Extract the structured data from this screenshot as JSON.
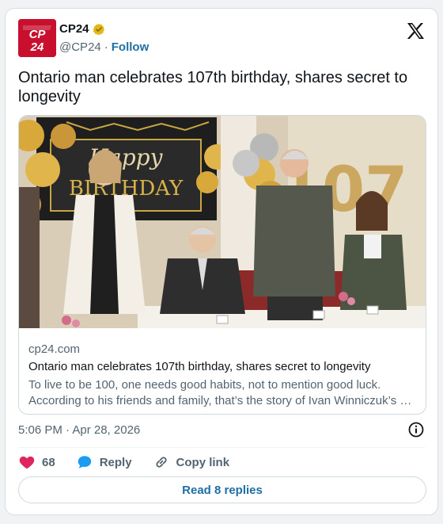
{
  "author": {
    "name": "CP24",
    "handle": "@CP24",
    "separator": "·",
    "follow_label": "Follow",
    "avatar_text": "CP24",
    "verified_color": "#e2b719",
    "brand_color": "#c8102e"
  },
  "tweet": {
    "text": "Ontario man celebrates 107th birthday, shares secret to longevity"
  },
  "link_card": {
    "domain": "cp24.com",
    "title": "Ontario man celebrates 107th birthday, shares secret to longevity",
    "description_line1": "To live to be 100, one needs good habits, not to mention good luck.",
    "description_line2": "According to his friends and family, that’s the story of Ivan Winniczuk’s …",
    "image_banner_text_1": "Happy",
    "image_banner_text_2": "BIRTHDAY",
    "image_balloon_number": "107"
  },
  "meta": {
    "timestamp": "5:06 PM · Apr 28, 2026"
  },
  "actions": {
    "like_count": "68",
    "reply_label": "Reply",
    "copy_link_label": "Copy link",
    "like_color": "#e0245e",
    "reply_color": "#1d9bf0"
  },
  "footer": {
    "read_replies_label": "Read 8 replies"
  }
}
